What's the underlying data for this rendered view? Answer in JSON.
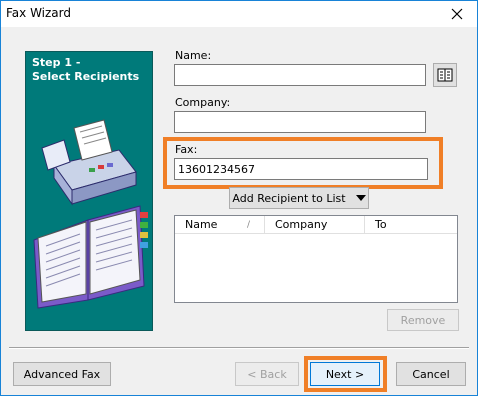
{
  "window": {
    "title": "Fax Wizard",
    "accent": "#1883d7"
  },
  "sidebar": {
    "step_line1": "Step 1 -",
    "step_line2": "Select Recipients",
    "bg_color": "#007a7a"
  },
  "form": {
    "name_label": "Name:",
    "name_value": "",
    "company_label": "Company:",
    "company_value": "",
    "fax_label": "Fax:",
    "fax_value": "13601234567",
    "address_book_icon": "address-book-icon"
  },
  "add_recipient": {
    "label": "Add Recipient to List",
    "icon": "triangle-down-icon"
  },
  "recipient_list": {
    "columns": [
      {
        "label": "Name"
      },
      {
        "label": "Company"
      },
      {
        "label": "To"
      }
    ],
    "rows": []
  },
  "remove_label": "Remove",
  "footer": {
    "advanced_label": "Advanced Fax",
    "back_label": "< Back",
    "next_label": "Next >",
    "cancel_label": "Cancel"
  },
  "highlight_color": "#f07f27"
}
